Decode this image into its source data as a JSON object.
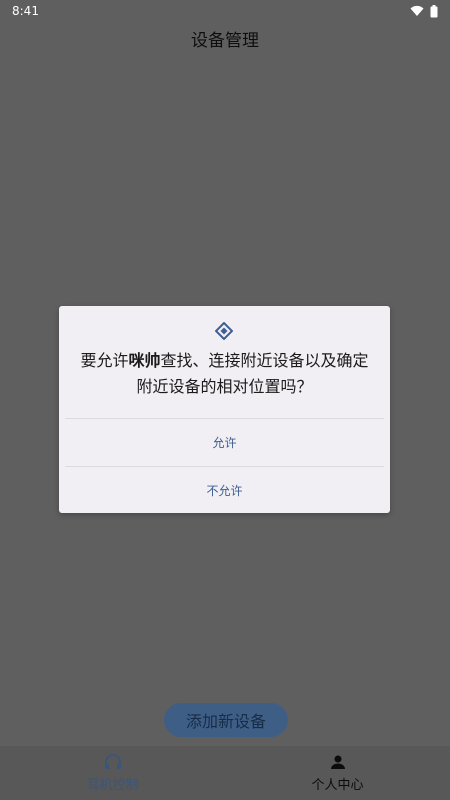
{
  "status_bar": {
    "time": "8:41"
  },
  "header": {
    "title": "设备管理"
  },
  "main": {
    "add_device_label": "添加新设备"
  },
  "bottom_nav": {
    "items": [
      {
        "label": "耳机控制",
        "icon": "headphones-icon",
        "active": true
      },
      {
        "label": "个人中心",
        "icon": "person-icon",
        "active": false
      }
    ]
  },
  "dialog": {
    "icon": "nearby-devices-icon",
    "message_prefix": "要允许",
    "app_name": "咪帅",
    "message_suffix": "查找、连接附近设备以及确定附近设备的相对位置吗？",
    "allow_label": "允许",
    "deny_label": "不允许"
  },
  "colors": {
    "accent": "#3d5f93",
    "dialog_bg": "#f2eff4",
    "scrim": "#5f5f5f"
  }
}
